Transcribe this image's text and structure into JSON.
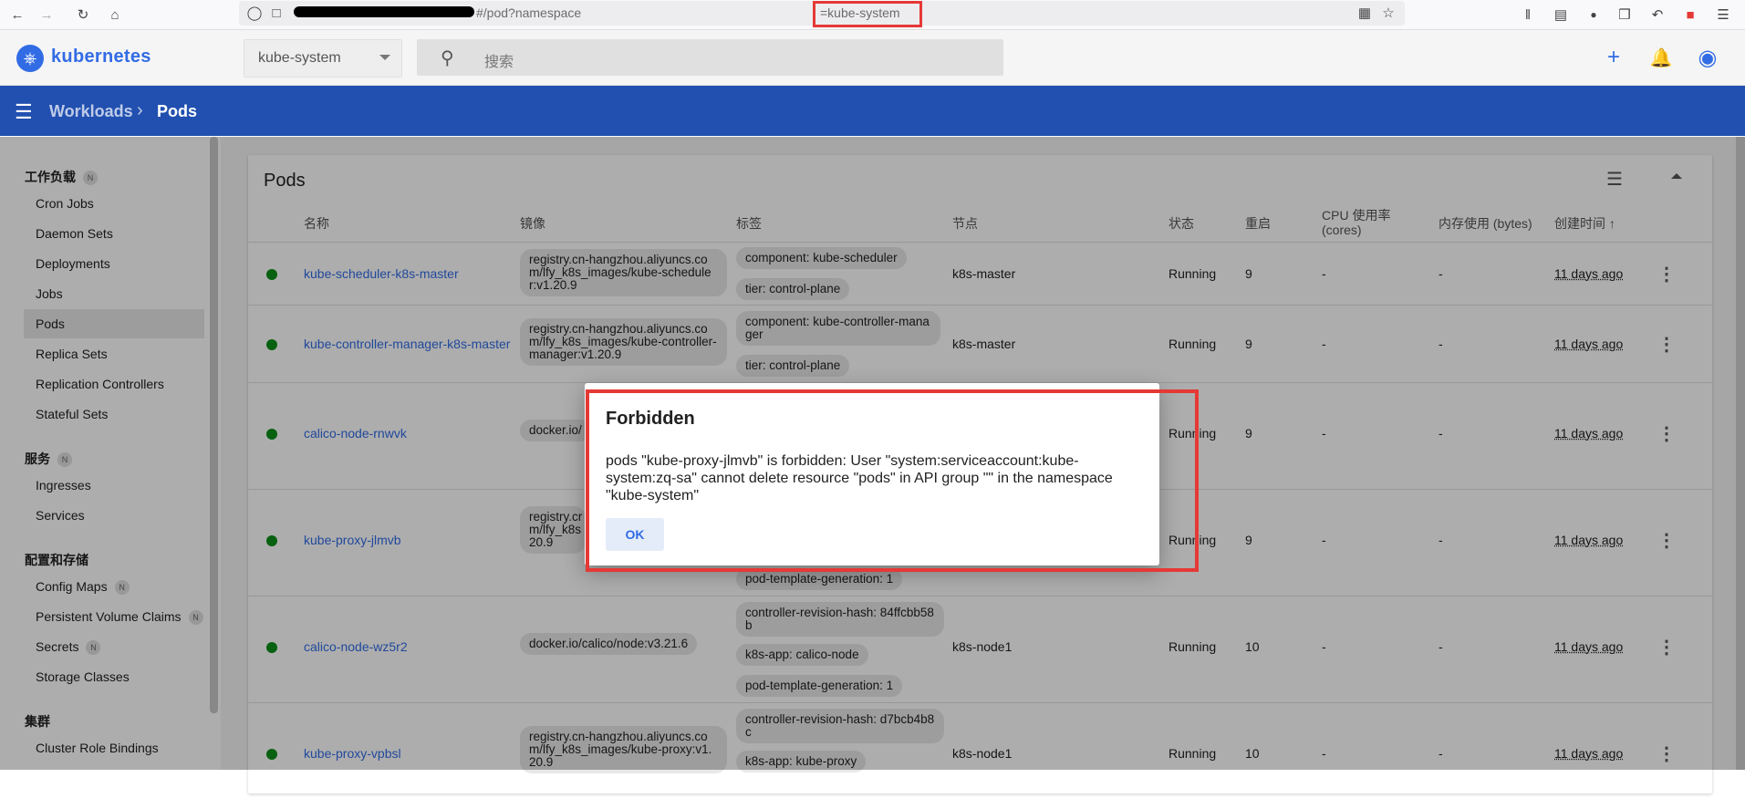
{
  "browser": {
    "url_suffix": "#/pod?namespace",
    "url_namespace": "=kube-system"
  },
  "header": {
    "brand": "kubernetes",
    "namespace": "kube-system",
    "search_placeholder": "搜索"
  },
  "nav": {
    "crumb_parent": "Workloads",
    "crumb_current": "Pods"
  },
  "sidebar": {
    "groups": [
      {
        "title": "工作负载",
        "badge": "N",
        "items": [
          "Cron Jobs",
          "Daemon Sets",
          "Deployments",
          "Jobs",
          "Pods",
          "Replica Sets",
          "Replication Controllers",
          "Stateful Sets"
        ]
      },
      {
        "title": "服务",
        "badge": "N",
        "items": [
          "Ingresses",
          "Services"
        ]
      },
      {
        "title": "配置和存储",
        "badge": "",
        "items": [
          "Config Maps",
          "Persistent Volume Claims",
          "Secrets",
          "Storage Classes"
        ]
      },
      {
        "title": "集群",
        "badge": "",
        "items": [
          "Cluster Role Bindings"
        ]
      }
    ],
    "item_badges": {
      "Config Maps": "N",
      "Persistent Volume Claims": "N",
      "Secrets": "N"
    },
    "active_item": "Pods"
  },
  "table": {
    "title": "Pods",
    "columns": {
      "name": "名称",
      "image": "镜像",
      "labels": "标签",
      "node": "节点",
      "status": "状态",
      "restarts": "重启",
      "cpu": "CPU 使用率 (cores)",
      "memory": "内存使用 (bytes)",
      "created": "创建时间"
    },
    "rows": [
      {
        "name": "kube-scheduler-k8s-master",
        "image": "registry.cn-hangzhou.aliyuncs.com/lfy_k8s_images/kube-scheduler:v1.20.9",
        "labels": [
          "component: kube-scheduler",
          "tier: control-plane"
        ],
        "node": "k8s-master",
        "status": "Running",
        "restarts": "9",
        "cpu": "-",
        "memory": "-",
        "created": "11 days ago"
      },
      {
        "name": "kube-controller-manager-k8s-master",
        "image": "registry.cn-hangzhou.aliyuncs.com/lfy_k8s_images/kube-controller-manager:v1.20.9",
        "labels": [
          "component: kube-controller-manager",
          "tier: control-plane"
        ],
        "node": "k8s-master",
        "status": "Running",
        "restarts": "9",
        "cpu": "-",
        "memory": "-",
        "created": "11 days ago"
      },
      {
        "name": "calico-node-rnwvk",
        "image": "docker.io/",
        "labels": [],
        "node": "",
        "status": "Running",
        "restarts": "9",
        "cpu": "-",
        "memory": "-",
        "created": "11 days ago"
      },
      {
        "name": "kube-proxy-jlmvb",
        "image": "registry.cr\nm/lfy_k8s\n20.9",
        "labels": [
          "pod-template-generation: 1"
        ],
        "node": "",
        "status": "Running",
        "restarts": "9",
        "cpu": "-",
        "memory": "-",
        "created": "11 days ago"
      },
      {
        "name": "calico-node-wz5r2",
        "image": "docker.io/calico/node:v3.21.6",
        "labels": [
          "controller-revision-hash: 84ffcbb58b",
          "k8s-app: calico-node",
          "pod-template-generation: 1"
        ],
        "node": "k8s-node1",
        "status": "Running",
        "restarts": "10",
        "cpu": "-",
        "memory": "-",
        "created": "11 days ago"
      },
      {
        "name": "kube-proxy-vpbsl",
        "image": "registry.cn-hangzhou.aliyuncs.com/lfy_k8s_images/kube-proxy:v1.20.9",
        "labels": [
          "controller-revision-hash: d7bcb4b8c",
          "k8s-app: kube-proxy"
        ],
        "node": "k8s-node1",
        "status": "Running",
        "restarts": "10",
        "cpu": "-",
        "memory": "-",
        "created": "11 days ago"
      }
    ]
  },
  "dialog": {
    "title": "Forbidden",
    "message": "pods \"kube-proxy-jlmvb\" is forbidden: User \"system:serviceaccount:kube-system:zq-sa\" cannot delete resource \"pods\" in API group \"\" in the namespace \"kube-system\"",
    "ok_label": "OK"
  },
  "colors": {
    "brand": "#326ce5",
    "nav": "#2150b0",
    "running": "#0b8f19",
    "highlight": "#e53935"
  },
  "icons": [
    "back-icon",
    "forward-icon",
    "reload-icon",
    "home-icon",
    "shield-icon",
    "lock-icon",
    "qr-icon",
    "star-icon",
    "library-icon",
    "sidebar-icon",
    "profile-icon",
    "crop-icon",
    "undo-icon",
    "extension-icon",
    "menu-icon",
    "kubernetes-logo",
    "search-icon",
    "plus-icon",
    "bell-icon",
    "account-icon",
    "filter-icon",
    "collapse-icon",
    "sort-arrow-icon",
    "kebab-icon"
  ]
}
